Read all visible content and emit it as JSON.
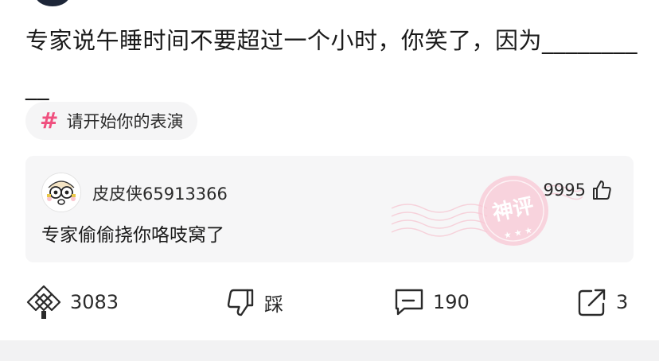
{
  "post": {
    "title": "专家说午睡时间不要超过一个小时，你笑了，因为__________"
  },
  "topic": {
    "icon": "hash-icon",
    "label": "请开始你的表演",
    "color": "#f0507f"
  },
  "hot_comment": {
    "username": "皮皮侠65913366",
    "like_count": "9995",
    "text": "专家偷偷挠你咯吱窝了",
    "stamp_text": "神评",
    "stamp_color": "#f6b9c9"
  },
  "actions": {
    "share": {
      "icon": "diamond-knot-icon",
      "count": "3083"
    },
    "dislike": {
      "icon": "thumbs-down-icon",
      "label": "踩"
    },
    "comment": {
      "icon": "comment-bubble-icon",
      "count": "190"
    },
    "forward": {
      "icon": "share-arrow-icon",
      "count": "3"
    }
  }
}
